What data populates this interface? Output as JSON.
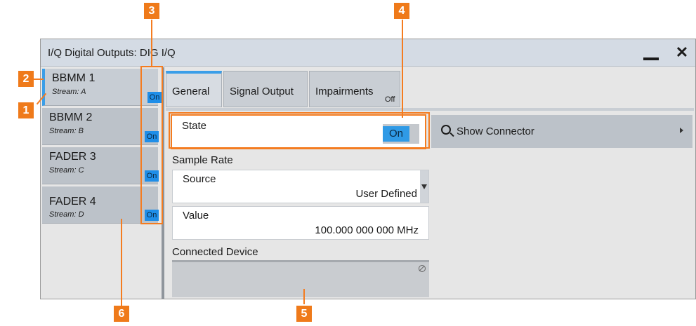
{
  "window": {
    "title": "I/Q Digital Outputs: DIG I/Q",
    "minimize_icon": "minimize-icon",
    "close_icon": "close-icon",
    "close_glyph": "✕"
  },
  "streams": [
    {
      "name": "BBMM 1",
      "stream": "Stream: A",
      "state": "On",
      "selected": true
    },
    {
      "name": "BBMM 2",
      "stream": "Stream: B",
      "state": "On",
      "selected": false
    },
    {
      "name": "FADER 3",
      "stream": "Stream: C",
      "state": "On",
      "selected": false
    },
    {
      "name": "FADER 4",
      "stream": "Stream: D",
      "state": "On",
      "selected": false
    }
  ],
  "tabs": [
    {
      "label": "General",
      "active": true
    },
    {
      "label": "Signal Output",
      "active": false
    },
    {
      "label": "Impairments",
      "active": false,
      "badge": "Off"
    }
  ],
  "general": {
    "state_label": "State",
    "state_value": "On",
    "sample_rate_heading": "Sample Rate",
    "source_label": "Source",
    "source_value": "User Defined",
    "value_label": "Value",
    "value_value": "100.000 000 000 MHz",
    "connected_device_heading": "Connected Device"
  },
  "show_connector": {
    "label": "Show Connector",
    "icon": "search-icon"
  },
  "callouts": [
    "1",
    "2",
    "3",
    "4",
    "5",
    "6"
  ],
  "colors": {
    "accent": "#3a9ee8",
    "on_badge": "#1f8ee8",
    "callout": "#ef7a1a",
    "titlebar": "#d4dbe4"
  }
}
